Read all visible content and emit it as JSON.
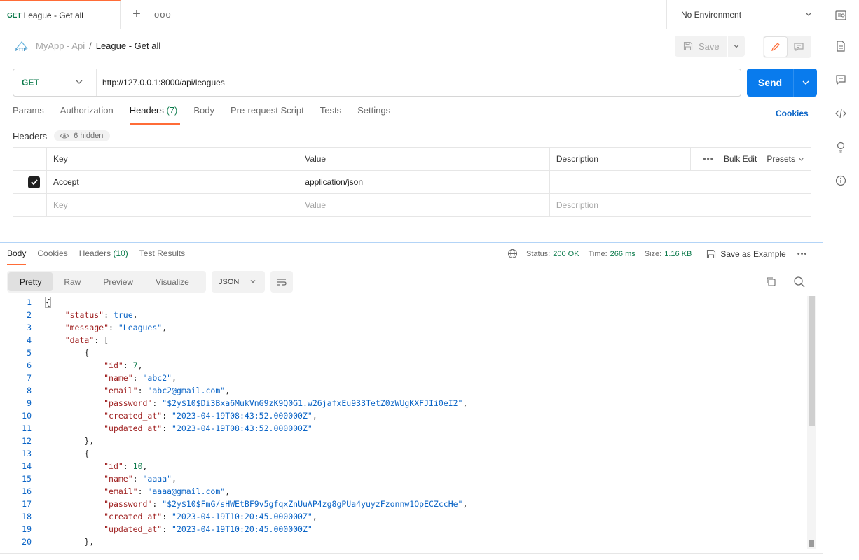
{
  "tab": {
    "method": "GET",
    "title": "League - Get all",
    "more": "ooo"
  },
  "environment": {
    "label": "No Environment"
  },
  "breadcrumb": {
    "parent": "MyApp - Api",
    "separator": "/",
    "current": "League - Get all",
    "http_label": "HTTP"
  },
  "toolbar": {
    "save_label": "Save"
  },
  "request": {
    "method": "GET",
    "url": "http://127.0.0.1:8000/api/leagues",
    "send_label": "Send"
  },
  "request_tabs": [
    {
      "label": "Params"
    },
    {
      "label": "Authorization"
    },
    {
      "label": "Headers",
      "count": "(7)"
    },
    {
      "label": "Body"
    },
    {
      "label": "Pre-request Script"
    },
    {
      "label": "Tests"
    },
    {
      "label": "Settings"
    }
  ],
  "cookies_label": "Cookies",
  "headers_section": {
    "title": "Headers",
    "hidden_label": "6 hidden"
  },
  "headers_table": {
    "columns": [
      "Key",
      "Value",
      "Description"
    ],
    "actions": {
      "bulk_edit": "Bulk Edit",
      "presets": "Presets"
    },
    "rows": [
      {
        "key": "Accept",
        "value": "application/json",
        "description": "",
        "checked": true
      }
    ],
    "placeholders": {
      "key": "Key",
      "value": "Value",
      "description": "Description"
    }
  },
  "response_tabs": [
    {
      "label": "Body"
    },
    {
      "label": "Cookies"
    },
    {
      "label": "Headers",
      "count": "(10)"
    },
    {
      "label": "Test Results"
    }
  ],
  "response_meta": {
    "status_label": "Status:",
    "status": "200 OK",
    "time_label": "Time:",
    "time": "266 ms",
    "size_label": "Size:",
    "size": "1.16 KB",
    "save_example": "Save as Example"
  },
  "view_modes": [
    "Pretty",
    "Raw",
    "Preview",
    "Visualize"
  ],
  "format": "JSON",
  "code_lines": [
    [
      [
        "p",
        "{"
      ]
    ],
    [
      [
        "p",
        "    "
      ],
      [
        "k",
        "\"status\""
      ],
      [
        "p",
        ": "
      ],
      [
        "b",
        "true"
      ],
      [
        "p",
        ","
      ]
    ],
    [
      [
        "p",
        "    "
      ],
      [
        "k",
        "\"message\""
      ],
      [
        "p",
        ": "
      ],
      [
        "s",
        "\"Leagues\""
      ],
      [
        "p",
        ","
      ]
    ],
    [
      [
        "p",
        "    "
      ],
      [
        "k",
        "\"data\""
      ],
      [
        "p",
        ": ["
      ]
    ],
    [
      [
        "p",
        "        {"
      ]
    ],
    [
      [
        "p",
        "            "
      ],
      [
        "k",
        "\"id\""
      ],
      [
        "p",
        ": "
      ],
      [
        "n",
        "7"
      ],
      [
        "p",
        ","
      ]
    ],
    [
      [
        "p",
        "            "
      ],
      [
        "k",
        "\"name\""
      ],
      [
        "p",
        ": "
      ],
      [
        "s",
        "\"abc2\""
      ],
      [
        "p",
        ","
      ]
    ],
    [
      [
        "p",
        "            "
      ],
      [
        "k",
        "\"email\""
      ],
      [
        "p",
        ": "
      ],
      [
        "s",
        "\"abc2@gmail.com\""
      ],
      [
        "p",
        ","
      ]
    ],
    [
      [
        "p",
        "            "
      ],
      [
        "k",
        "\"password\""
      ],
      [
        "p",
        ": "
      ],
      [
        "s",
        "\"$2y$10$Di3Bxa6MukVnG9zK9Q0G1.w26jafxEu933TetZ0zWUgKXFJIi0eI2\""
      ],
      [
        "p",
        ","
      ]
    ],
    [
      [
        "p",
        "            "
      ],
      [
        "k",
        "\"created_at\""
      ],
      [
        "p",
        ": "
      ],
      [
        "s",
        "\"2023-04-19T08:43:52.000000Z\""
      ],
      [
        "p",
        ","
      ]
    ],
    [
      [
        "p",
        "            "
      ],
      [
        "k",
        "\"updated_at\""
      ],
      [
        "p",
        ": "
      ],
      [
        "s",
        "\"2023-04-19T08:43:52.000000Z\""
      ]
    ],
    [
      [
        "p",
        "        },"
      ]
    ],
    [
      [
        "p",
        "        {"
      ]
    ],
    [
      [
        "p",
        "            "
      ],
      [
        "k",
        "\"id\""
      ],
      [
        "p",
        ": "
      ],
      [
        "n",
        "10"
      ],
      [
        "p",
        ","
      ]
    ],
    [
      [
        "p",
        "            "
      ],
      [
        "k",
        "\"name\""
      ],
      [
        "p",
        ": "
      ],
      [
        "s",
        "\"aaaa\""
      ],
      [
        "p",
        ","
      ]
    ],
    [
      [
        "p",
        "            "
      ],
      [
        "k",
        "\"email\""
      ],
      [
        "p",
        ": "
      ],
      [
        "s",
        "\"aaaa@gmail.com\""
      ],
      [
        "p",
        ","
      ]
    ],
    [
      [
        "p",
        "            "
      ],
      [
        "k",
        "\"password\""
      ],
      [
        "p",
        ": "
      ],
      [
        "s",
        "\"$2y$10$FmG/sHWEtBF9v5gfqxZnUuAP4zg8gPUa4yuyzFzonnw1OpECZccHe\""
      ],
      [
        "p",
        ","
      ]
    ],
    [
      [
        "p",
        "            "
      ],
      [
        "k",
        "\"created_at\""
      ],
      [
        "p",
        ": "
      ],
      [
        "s",
        "\"2023-04-19T10:20:45.000000Z\""
      ],
      [
        "p",
        ","
      ]
    ],
    [
      [
        "p",
        "            "
      ],
      [
        "k",
        "\"updated_at\""
      ],
      [
        "p",
        ": "
      ],
      [
        "s",
        "\"2023-04-19T10:20:45.000000Z\""
      ]
    ],
    [
      [
        "p",
        "        },"
      ]
    ]
  ],
  "colors": {
    "accent": "#ff6c37",
    "send": "#097bed",
    "method_get": "#0b7a4b",
    "json_key": "#9c1a1a",
    "json_string": "#0a64c6"
  }
}
